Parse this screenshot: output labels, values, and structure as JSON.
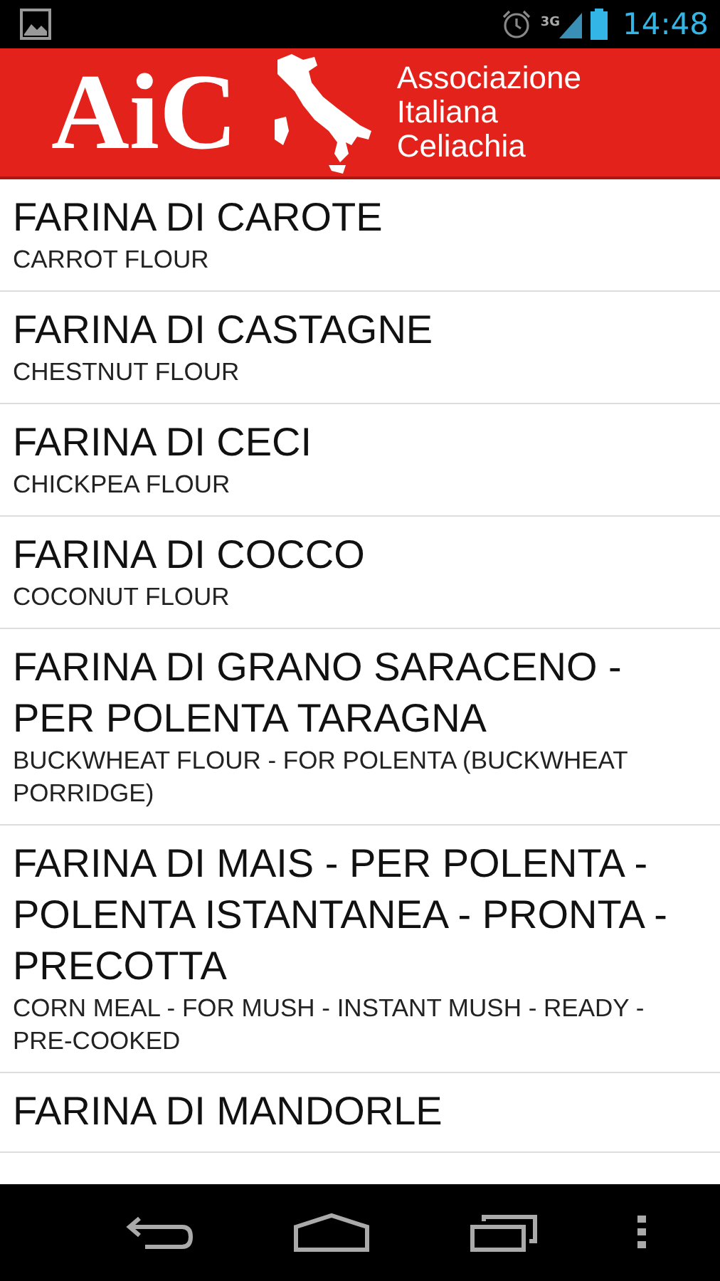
{
  "status_bar": {
    "network": "3G",
    "time": "14:48"
  },
  "header": {
    "logo": "AiC",
    "org_name": [
      "Associazione",
      "Italiana",
      "Celiachia"
    ]
  },
  "items": [
    {
      "title": "FARINA DI CAROTE",
      "subtitle": "CARROT FLOUR"
    },
    {
      "title": "FARINA DI CASTAGNE",
      "subtitle": "CHESTNUT FLOUR"
    },
    {
      "title": "FARINA DI CECI",
      "subtitle": "CHICKPEA FLOUR"
    },
    {
      "title": "FARINA DI COCCO",
      "subtitle": "COCONUT FLOUR"
    },
    {
      "title": "FARINA DI GRANO SARACENO - PER POLENTA TARAGNA",
      "subtitle": "BUCKWHEAT FLOUR - FOR POLENTA (BUCKWHEAT PORRIDGE)"
    },
    {
      "title": "FARINA DI MAIS - PER POLENTA - POLENTA ISTANTANEA - PRONTA - PRECOTTA",
      "subtitle": "CORN MEAL - FOR MUSH - INSTANT MUSH - READY - PRE-COOKED"
    },
    {
      "title": "FARINA DI MANDORLE"
    }
  ]
}
